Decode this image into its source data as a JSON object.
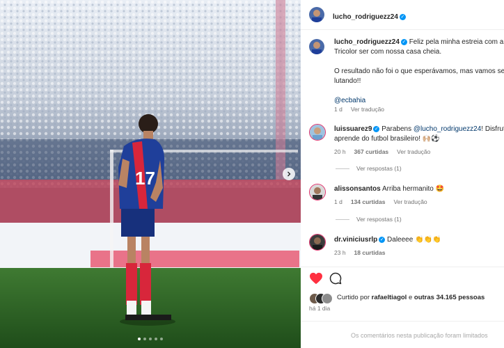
{
  "post": {
    "author": "lucho_rodriguezz24",
    "caption_line1": "Feliz pela minha estreia com a c",
    "caption_line2": "Tricolor ser com nossa casa cheia.",
    "caption_line3": "O resultado não foi o que esperávamos, mas vamos se",
    "caption_line4": "lutando!!",
    "caption_tag": "@ecbahia",
    "caption_age": "1 d",
    "see_translation": "Ver tradução",
    "carousel_dots": 5,
    "carousel_active": 1
  },
  "comments": [
    {
      "user": "luissuarez9",
      "text_before": "Parabens ",
      "mention": "@lucho_rodriguezz24",
      "text_after": "! Disfruta",
      "text_line2": "aprende do futbol brasileiro! 🙌🏼⚽",
      "age": "20 h",
      "likes": "367 curtidas",
      "translate": "Ver tradução",
      "replies": "Ver respostas (1)"
    },
    {
      "user": "alissonsantos",
      "text": "Arriba hermanito 🤩",
      "age": "1 d",
      "likes": "134 curtidas",
      "translate": "Ver tradução",
      "replies": "Ver respostas (1)"
    },
    {
      "user": "dr.viniciusrlp",
      "text": "Daleeee 👏👏👏",
      "age": "23 h",
      "likes": "18 curtidas"
    }
  ],
  "likes": {
    "prefix": "Curtido por ",
    "user": "rafaeltiagol",
    "middle": " e ",
    "others": "outras 34.165 pessoas",
    "age": "há 1 dia"
  },
  "footer_text": "Os comentários nesta publicação foram limitados",
  "colors": {
    "verified": "#0095f6",
    "heart": "#ff3040",
    "link": "#00376b"
  },
  "icons": {
    "verified": "✓",
    "next": "chevron-right-icon",
    "heart": "heart-filled-icon",
    "comment": "comment-icon"
  }
}
